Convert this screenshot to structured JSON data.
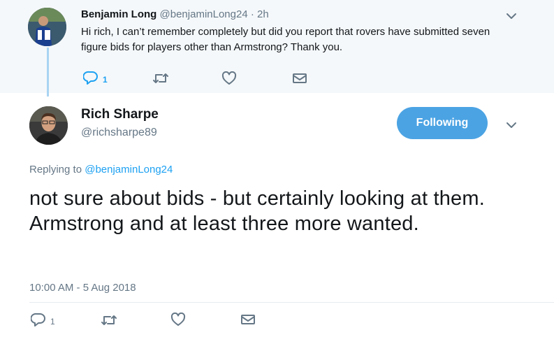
{
  "parent_tweet": {
    "name": "Benjamin Long",
    "handle": "@benjaminLong24",
    "separator": "·",
    "time": "2h",
    "text": "Hi rich, I can’t remember completely but did you report that rovers have submitted seven figure bids for players other than Armstrong? Thank you.",
    "reply_count": "1",
    "retweet_count": "",
    "like_count": ""
  },
  "main_tweet": {
    "name": "Rich Sharpe",
    "handle": "@richsharpe89",
    "follow_label": "Following",
    "replying_prefix": "Replying to",
    "replying_handle": "@benjaminLong24",
    "text": "not sure about bids - but certainly looking at them. Armstrong and at least three more wanted.",
    "date": "10:00 AM - 5 Aug 2018",
    "reply_count": "1",
    "retweet_count": "",
    "like_count": ""
  },
  "colors": {
    "accent": "#1da1f2",
    "follow_button": "#4ba3e3",
    "muted_text": "#657786",
    "parent_bg": "#f5f8fa",
    "thread_line": "#a9d4f2"
  },
  "icons": {
    "reply": "reply-icon",
    "retweet": "retweet-icon",
    "like": "heart-icon",
    "message": "envelope-icon",
    "menu": "chevron-down-icon"
  }
}
